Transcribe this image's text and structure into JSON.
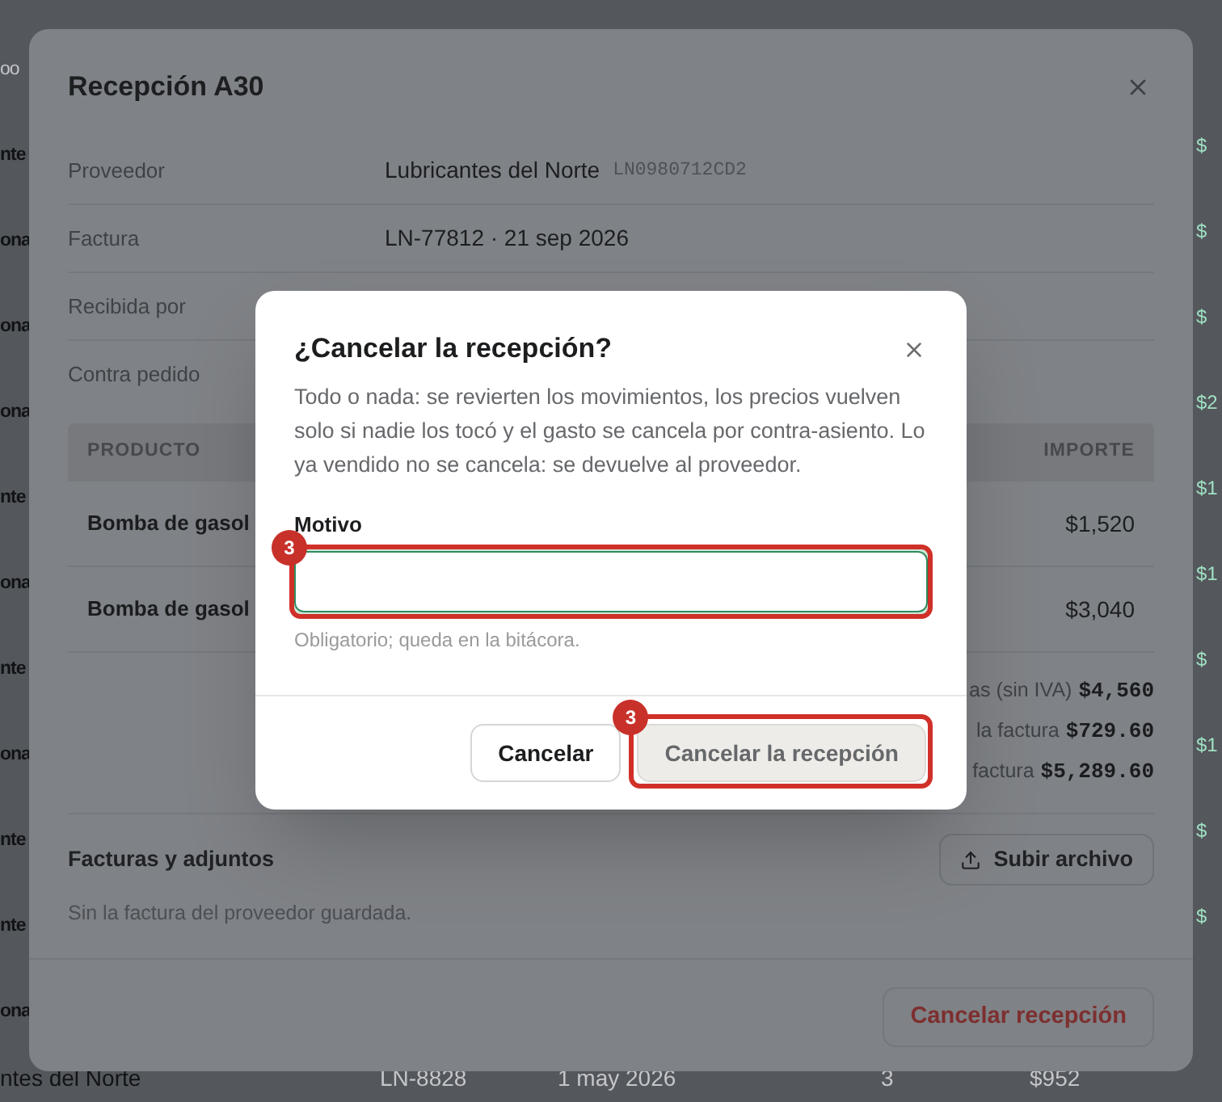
{
  "background_table": {
    "header_fragment": "oo",
    "rows": [
      {
        "column_1": "nte",
        "column_2": "$"
      },
      {
        "column_1": "ona",
        "column_2": "$"
      },
      {
        "column_1": "ona",
        "column_2": "$"
      },
      {
        "column_1": "ona",
        "column_2": "$2"
      },
      {
        "column_1": "nte",
        "column_2": "$1"
      },
      {
        "column_1": "ona",
        "column_2": "$1"
      },
      {
        "column_1": "nte",
        "column_2": "$"
      },
      {
        "column_1": "ona",
        "column_2": "$1"
      },
      {
        "column_1": "nte",
        "column_2": "$"
      },
      {
        "column_1": "nte",
        "column_2": "$"
      },
      {
        "column_1": "ona"
      }
    ],
    "last_row": [
      "ntes del Norte",
      "LN-8828",
      "1 may 2026",
      "3",
      "$952"
    ]
  },
  "reception_modal": {
    "title": "Recepción A30",
    "details": [
      {
        "label": "Proveedor",
        "value": "Lubricantes del Norte",
        "code": "LN0980712CD2"
      },
      {
        "label": "Factura",
        "value": "LN-77812 · 21 sep 2026"
      },
      {
        "label": "Recibida por"
      },
      {
        "label": "Contra pedido"
      }
    ],
    "table": {
      "columns": [
        "PRODUCTO",
        "IMPORTE"
      ],
      "rows": [
        {
          "product": "Bomba de gasol",
          "amount": "$1,520"
        },
        {
          "product": "Bomba de gasol",
          "amount": "$3,040"
        }
      ]
    },
    "totals": [
      {
        "label": "as (sin IVA)",
        "value": "$4,560"
      },
      {
        "label": "la factura",
        "value": "$729.60"
      },
      {
        "label": "factura",
        "value": "$5,289.60"
      }
    ],
    "attachments": {
      "title": "Facturas y adjuntos",
      "upload_button": "Subir archivo",
      "empty_text": "Sin la factura del proveedor guardada."
    },
    "footer_button": "Cancelar recepción"
  },
  "cancel_dialog": {
    "title": "¿Cancelar la recepción?",
    "message": "Todo o nada: se revierten los movimientos, los precios vuelven solo si nadie los tocó y el gasto se cancela por contra-asiento. Lo ya vendido no se cancela: se devuelve al proveedor.",
    "field": {
      "label": "Motivo",
      "focused": true,
      "hint": "Obligatorio; queda en la bitácora.",
      "annotation": "3"
    },
    "buttons": [
      {
        "label": "Cancelar",
        "kind": "secondary",
        "disabled": false
      },
      {
        "label": "Cancelar la recepción",
        "kind": "danger",
        "disabled": true,
        "annotation": "3"
      }
    ]
  }
}
